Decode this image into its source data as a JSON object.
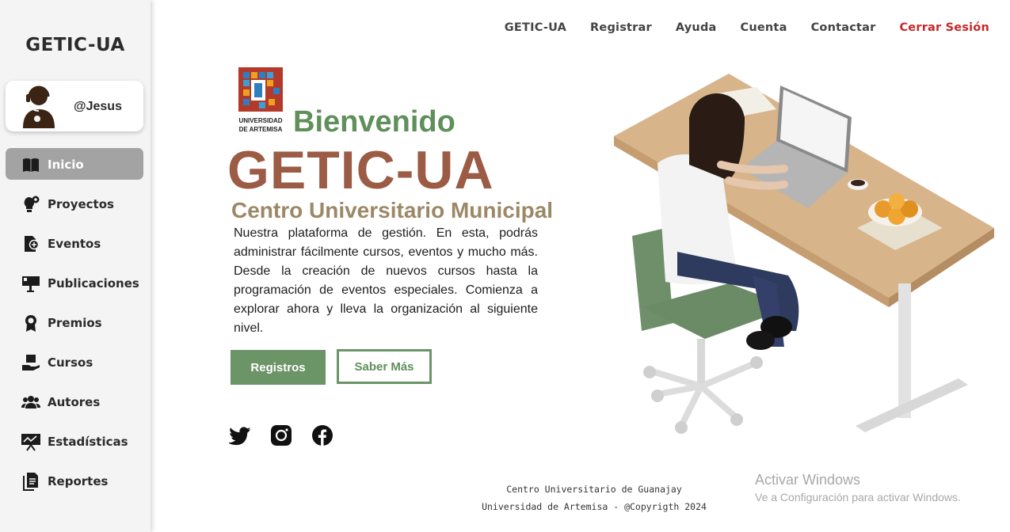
{
  "sidebar": {
    "brand": "GETIC-UA",
    "profile": {
      "username": "@Jesus",
      "avatar_icon": "user-headset-icon"
    },
    "items": [
      {
        "label": "Inicio",
        "icon": "book-open-icon",
        "active": true
      },
      {
        "label": "Proyectos",
        "icon": "lightbulb-gear-icon",
        "active": false
      },
      {
        "label": "Eventos",
        "icon": "calendar-add-icon",
        "active": false
      },
      {
        "label": "Publicaciones",
        "icon": "billboard-icon",
        "active": false
      },
      {
        "label": "Premios",
        "icon": "award-icon",
        "active": false
      },
      {
        "label": "Cursos",
        "icon": "hand-book-icon",
        "active": false
      },
      {
        "label": "Autores",
        "icon": "users-icon",
        "active": false
      },
      {
        "label": "Estadísticas",
        "icon": "presentation-chart-icon",
        "active": false
      },
      {
        "label": "Reportes",
        "icon": "report-document-icon",
        "active": false
      }
    ]
  },
  "topnav": {
    "links": [
      "GETIC-UA",
      "Registrar",
      "Ayuda",
      "Cuenta",
      "Contactar"
    ],
    "logout": "Cerrar Sesión"
  },
  "hero": {
    "welcome": "Bienvenido",
    "title": "GETIC-UA",
    "subtitle": "Centro Universitario Municipal",
    "description": "Nuestra plataforma de gestión. En esta, podrás administrar fácilmente cursos, eventos y mucho más. Desde la creación de nuevos cursos hasta la programación de eventos especiales. Comienza a explorar ahora y lleva la organización al siguiente nivel.",
    "primary_button": "Registros",
    "secondary_button": "Saber Más",
    "logo_text": [
      "UNIVERSIDAD",
      "DE ARTEMISA"
    ],
    "social": [
      "twitter-icon",
      "instagram-icon",
      "facebook-icon"
    ]
  },
  "footer": {
    "line1": "Centro Universitario de Guanajay",
    "line2": "Universidad de Artemisa - @Copyrigth 2024"
  },
  "watermark": {
    "title": "Activar Windows",
    "subtitle": "Ve a Configuración para activar Windows."
  },
  "colors": {
    "green": "#6b9467",
    "brown": "#9b5b45",
    "tan": "#9c8866",
    "logout": "#c62828",
    "active_nav": "#a3a3a3"
  }
}
